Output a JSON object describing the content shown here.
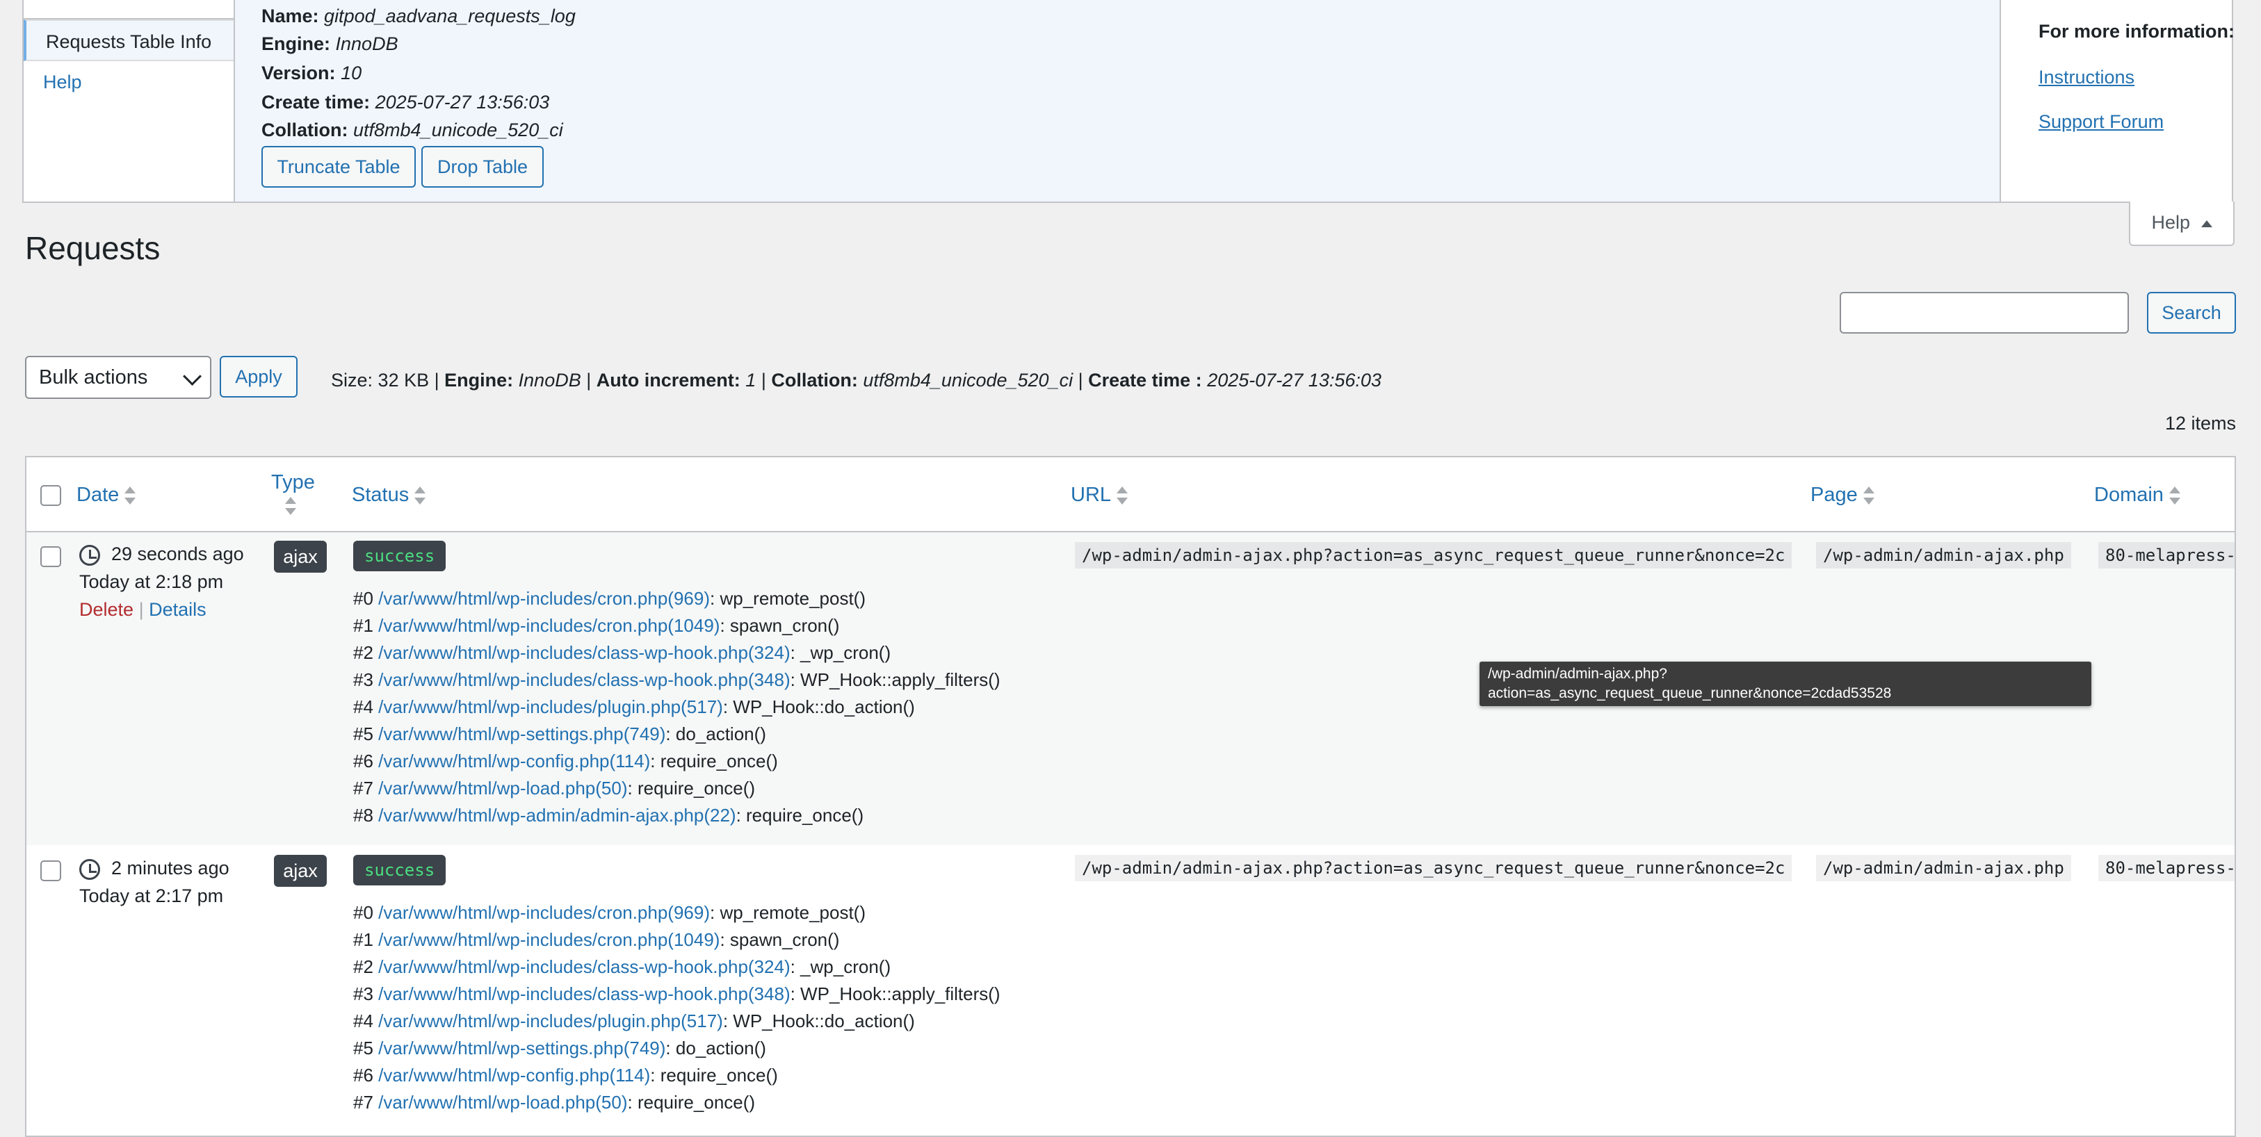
{
  "help": {
    "tabs": [
      "Requests Table Info",
      "Help"
    ],
    "info": [
      {
        "label": "Name:",
        "value": "gitpod_aadvana_requests_log"
      },
      {
        "label": "Engine:",
        "value": "InnoDB"
      },
      {
        "label": "Version:",
        "value": "10"
      },
      {
        "label": "Create time:",
        "value": "2025-07-27 13:56:03"
      },
      {
        "label": "Collation:",
        "value": "utf8mb4_unicode_520_ci"
      }
    ],
    "truncate_label": "Truncate Table",
    "drop_label": "Drop Table",
    "more_info": "For more information:",
    "links": [
      "Instructions",
      "Support Forum"
    ],
    "toggle_label": "Help"
  },
  "page": {
    "title": "Requests",
    "search_label": "Search",
    "search_value": "",
    "bulk_label": "Bulk actions",
    "apply_label": "Apply",
    "meta": {
      "size_label": "Size:",
      "size": "32 KB",
      "engine_label": "Engine:",
      "engine": "InnoDB",
      "autoinc_label": "Auto increment:",
      "autoinc": "1",
      "collation_label": "Collation:",
      "collation": "utf8mb4_unicode_520_ci",
      "create_label": "Create time :",
      "create": "2025-07-27 13:56:03"
    },
    "items_count": "12 items"
  },
  "table": {
    "headers": {
      "date": "Date",
      "type": "Type",
      "status": "Status",
      "url": "URL",
      "page": "Page",
      "domain": "Domain"
    },
    "rows": [
      {
        "ago": "29 seconds ago",
        "when": "Today at 2:18 pm",
        "delete": "Delete",
        "sep": "|",
        "details": "Details",
        "type": "ajax",
        "status": "success",
        "url": "/wp-admin/admin-ajax.php?action=as_async_request_queue_runner&nonce=2c",
        "page": "/wp-admin/admin-ajax.php",
        "domain": "80-melapress-",
        "trace": [
          [
            "#0",
            "/var/www/html/wp-includes/cron.php(969)",
            ": wp_remote_post()"
          ],
          [
            "#1",
            "/var/www/html/wp-includes/cron.php(1049)",
            ": spawn_cron()"
          ],
          [
            "#2",
            "/var/www/html/wp-includes/class-wp-hook.php(324)",
            ": _wp_cron()"
          ],
          [
            "#3",
            "/var/www/html/wp-includes/class-wp-hook.php(348)",
            ": WP_Hook::apply_filters()"
          ],
          [
            "#4",
            "/var/www/html/wp-includes/plugin.php(517)",
            ": WP_Hook::do_action()"
          ],
          [
            "#5",
            "/var/www/html/wp-settings.php(749)",
            ": do_action()"
          ],
          [
            "#6",
            "/var/www/html/wp-config.php(114)",
            ": require_once()"
          ],
          [
            "#7",
            "/var/www/html/wp-load.php(50)",
            ": require_once()"
          ],
          [
            "#8",
            "/var/www/html/wp-admin/admin-ajax.php(22)",
            ": require_once()"
          ]
        ]
      },
      {
        "ago": "2 minutes ago",
        "when": "Today at 2:17 pm",
        "type": "ajax",
        "status": "success",
        "url": "/wp-admin/admin-ajax.php?action=as_async_request_queue_runner&nonce=2c",
        "page": "/wp-admin/admin-ajax.php",
        "domain": "80-melapress-",
        "trace": [
          [
            "#0",
            "/var/www/html/wp-includes/cron.php(969)",
            ": wp_remote_post()"
          ],
          [
            "#1",
            "/var/www/html/wp-includes/cron.php(1049)",
            ": spawn_cron()"
          ],
          [
            "#2",
            "/var/www/html/wp-includes/class-wp-hook.php(324)",
            ": _wp_cron()"
          ],
          [
            "#3",
            "/var/www/html/wp-includes/class-wp-hook.php(348)",
            ": WP_Hook::apply_filters()"
          ],
          [
            "#4",
            "/var/www/html/wp-includes/plugin.php(517)",
            ": WP_Hook::do_action()"
          ],
          [
            "#5",
            "/var/www/html/wp-settings.php(749)",
            ": do_action()"
          ],
          [
            "#6",
            "/var/www/html/wp-config.php(114)",
            ": require_once()"
          ],
          [
            "#7",
            "/var/www/html/wp-load.php(50)",
            ": require_once()"
          ]
        ]
      }
    ],
    "tooltip": {
      "line1": "/wp-admin/admin-ajax.php?",
      "line2": "action=as_async_request_queue_runner&nonce=2cdad53528"
    }
  }
}
